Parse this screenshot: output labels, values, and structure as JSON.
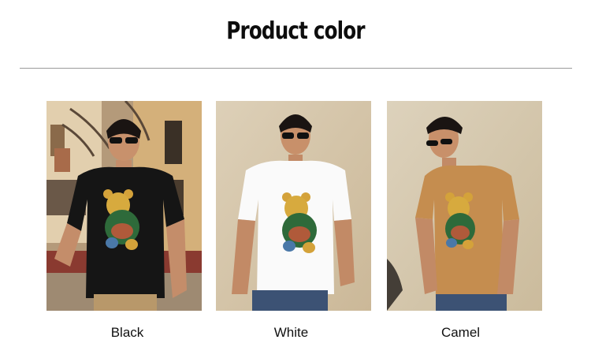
{
  "page": {
    "title": "Product color"
  },
  "colors": {
    "accent": "#0d0d0d",
    "divider": "#9a9a9a"
  },
  "variants": [
    {
      "label": "Black",
      "shirt_color": "#151515",
      "bg": "street-scene"
    },
    {
      "label": "White",
      "shirt_color": "#fafafa",
      "bg": "beige-wall"
    },
    {
      "label": "Camel",
      "shirt_color": "#c58d4f",
      "bg": "beige-wall"
    }
  ]
}
